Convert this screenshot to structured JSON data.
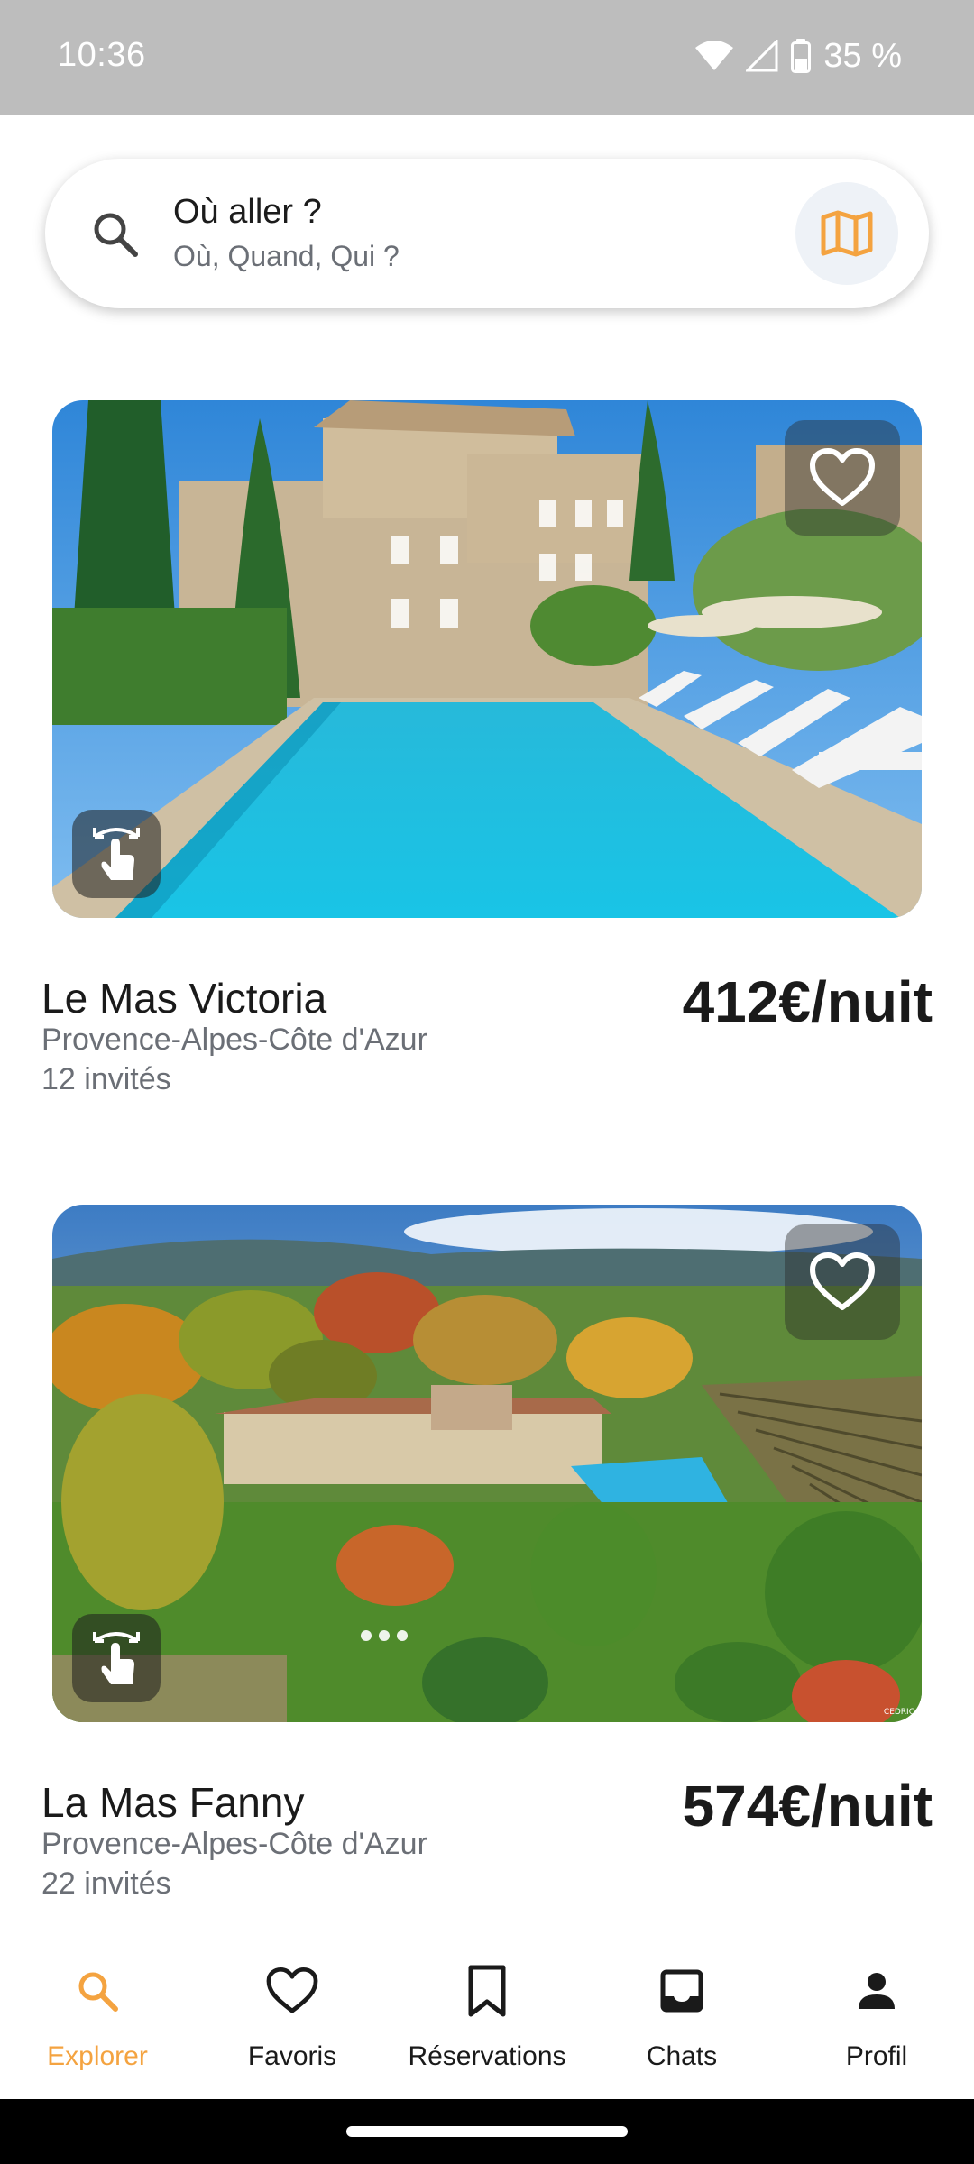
{
  "status_bar": {
    "time": "10:36",
    "battery": "35 %"
  },
  "search": {
    "title": "Où aller ?",
    "subtitle": "Où, Quand, Qui ?",
    "icon": "search-icon",
    "map_icon": "map-icon",
    "accent_color": "#f4a340"
  },
  "listings": [
    {
      "name": "Le Mas Victoria",
      "region": "Provence-Alpes-Côte d'Azur",
      "guests": "12 invités",
      "price": "412€/nuit",
      "favorite_icon": "heart-outline-icon",
      "swipe_icon": "swipe-hand-icon"
    },
    {
      "name": "La Mas Fanny",
      "region": "Provence-Alpes-Côte d'Azur",
      "guests": "22 invités",
      "price": "574€/nuit",
      "favorite_icon": "heart-outline-icon",
      "swipe_icon": "swipe-hand-icon",
      "photo_dots": 3,
      "photo_credit": "CEDRIC"
    }
  ],
  "bottom_nav": {
    "items": [
      {
        "label": "Explorer",
        "icon": "search-icon",
        "active": true
      },
      {
        "label": "Favoris",
        "icon": "heart-outline-icon",
        "active": false
      },
      {
        "label": "Réservations",
        "icon": "bookmark-icon",
        "active": false
      },
      {
        "label": "Chats",
        "icon": "inbox-icon",
        "active": false
      },
      {
        "label": "Profil",
        "icon": "person-icon",
        "active": false
      }
    ]
  }
}
